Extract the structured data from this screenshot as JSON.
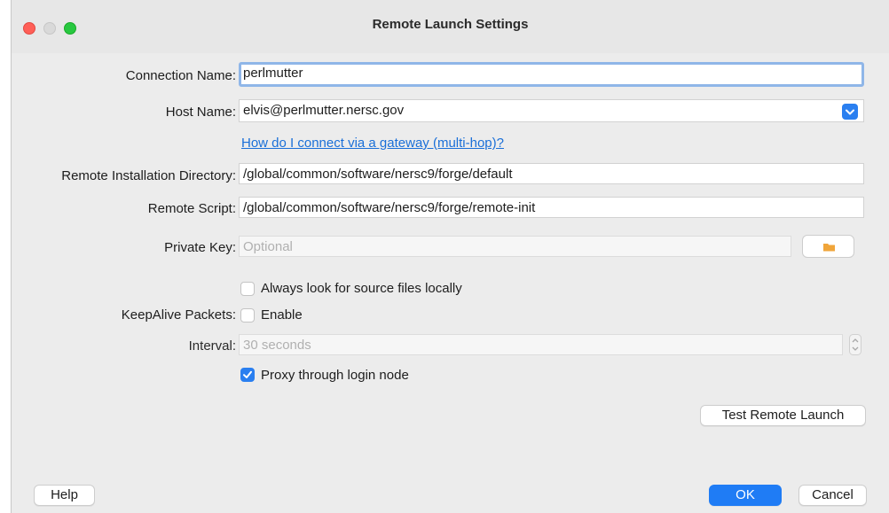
{
  "window": {
    "title": "Remote Launch Settings"
  },
  "form": {
    "connection_name": {
      "label": "Connection Name:",
      "value": "perlmutter"
    },
    "host_name": {
      "label": "Host Name:",
      "value": "elvis@perlmutter.nersc.gov"
    },
    "gateway_link": "How do I connect via a gateway (multi-hop)?",
    "remote_install_dir": {
      "label": "Remote Installation Directory:",
      "value": "/global/common/software/nersc9/forge/default"
    },
    "remote_script": {
      "label": "Remote Script:",
      "value": "/global/common/software/nersc9/forge/remote-init"
    },
    "private_key": {
      "label": "Private Key:",
      "placeholder": "Optional"
    },
    "always_look_local": {
      "label": "Always look for source files locally",
      "checked": false
    },
    "keepalive": {
      "label": "KeepAlive Packets:",
      "enable_label": "Enable",
      "checked": false
    },
    "interval": {
      "label": "Interval:",
      "placeholder": "30 seconds"
    },
    "proxy_login": {
      "label": "Proxy through login node",
      "checked": true
    }
  },
  "buttons": {
    "test_remote_launch": "Test Remote Launch",
    "help": "Help",
    "ok": "OK",
    "cancel": "Cancel"
  },
  "icons": {
    "close": "traffic-light-close",
    "minimize": "traffic-light-minimize",
    "zoom": "traffic-light-zoom",
    "dropdown": "chevron-down-icon",
    "folder": "folder-icon",
    "stepper": "stepper-icon",
    "checkmark": "checkmark-icon"
  },
  "colors": {
    "accent": "#1f7cf5",
    "link": "#1a6fd8",
    "focus_ring": "#8fb6e8",
    "folder": "#f0a53a"
  }
}
